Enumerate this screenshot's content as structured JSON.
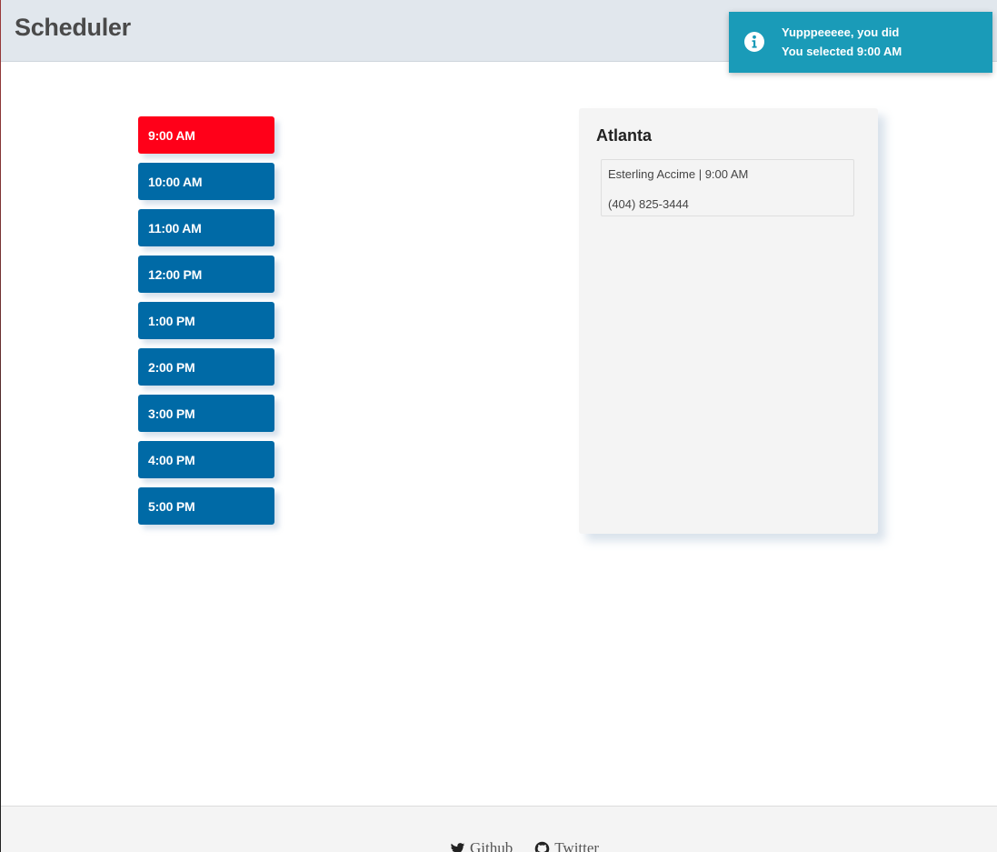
{
  "header": {
    "title": "Scheduler"
  },
  "toast": {
    "icon": "info-icon",
    "title": "Yupppeeeee, you did",
    "message": "You selected 9:00 AM",
    "color": "#1a9bb8"
  },
  "time_slots": [
    {
      "label": "9:00 AM",
      "selected": true
    },
    {
      "label": "10:00 AM",
      "selected": false
    },
    {
      "label": "11:00 AM",
      "selected": false
    },
    {
      "label": "12:00 PM",
      "selected": false
    },
    {
      "label": "1:00 PM",
      "selected": false
    },
    {
      "label": "2:00 PM",
      "selected": false
    },
    {
      "label": "3:00 PM",
      "selected": false
    },
    {
      "label": "4:00 PM",
      "selected": false
    },
    {
      "label": "5:00 PM",
      "selected": false
    }
  ],
  "slot_colors": {
    "default": "#006aa6",
    "selected": "#ff0019"
  },
  "location": {
    "name": "Atlanta",
    "appointments": [
      {
        "summary": "Esterling Accime | 9:00 AM",
        "phone": "(404) 825-3444"
      }
    ]
  },
  "footer": {
    "links": [
      {
        "label": "Github",
        "icon": "twitter-bird-icon"
      },
      {
        "label": "Twitter",
        "icon": "github-octocat-icon"
      }
    ]
  }
}
